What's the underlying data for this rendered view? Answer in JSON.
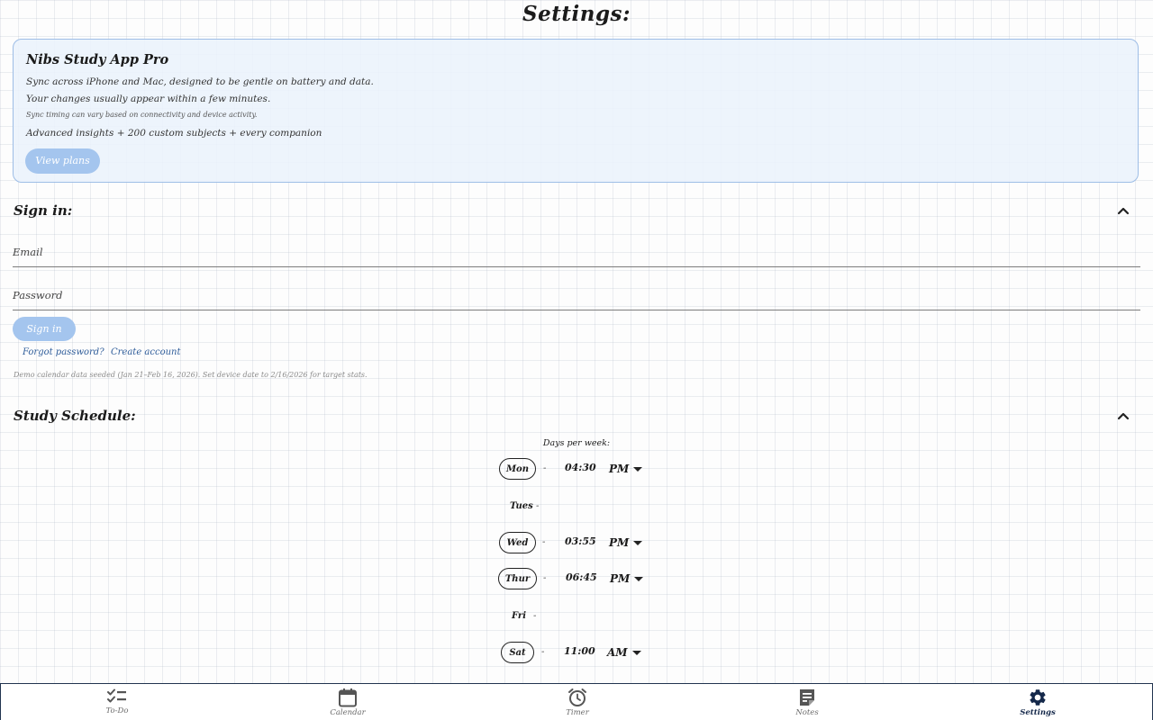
{
  "page": {
    "title": "Settings:"
  },
  "pro_card": {
    "title": "Nibs Study App Pro",
    "line1": "Sync across iPhone and Mac, designed to be gentle on battery and data.",
    "line2": "Your changes usually appear within a few minutes.",
    "line3": "Sync timing can vary based on connectivity and device activity.",
    "line4": "Advanced insights + 200 custom subjects + every companion",
    "button_label": "View plans"
  },
  "sign_in": {
    "heading": "Sign in:",
    "email_placeholder": "Email",
    "password_placeholder": "Password",
    "button_label": "Sign in",
    "forgot_label": "Forgot password?",
    "create_label": "Create account",
    "demo_note": "Demo calendar data seeded (Jan 21–Feb 16, 2026). Set device date to 2/16/2026 for target stats."
  },
  "schedule": {
    "heading": "Study Schedule:",
    "days_label": "Days per week:",
    "days": [
      {
        "day": "Mon",
        "active": true,
        "dash": "-",
        "time": "04:30",
        "ampm": "PM"
      },
      {
        "day": "Tues",
        "active": false,
        "dash": "-"
      },
      {
        "day": "Wed",
        "active": true,
        "dash": "-",
        "time": "03:55",
        "ampm": "PM"
      },
      {
        "day": "Thur",
        "active": true,
        "dash": "-",
        "time": "06:45",
        "ampm": "PM"
      },
      {
        "day": "Fri",
        "active": false,
        "dash": "-"
      },
      {
        "day": "Sat",
        "active": true,
        "dash": "-",
        "time": "11:00",
        "ampm": "AM"
      }
    ]
  },
  "tabbar": {
    "tabs": [
      {
        "label": "To-Do",
        "icon": "checklist-icon",
        "active": false
      },
      {
        "label": "Calendar",
        "icon": "calendar-icon",
        "active": false
      },
      {
        "label": "Timer",
        "icon": "alarm-clock-icon",
        "active": false
      },
      {
        "label": "Notes",
        "icon": "note-icon",
        "active": false
      },
      {
        "label": "Settings",
        "icon": "gear-icon",
        "active": true
      }
    ]
  },
  "colors": {
    "accent_button": "#a4c5ee",
    "card_border": "#9dbde6",
    "link": "#2f5d9a",
    "active_tab": "#14284a",
    "inactive_tab": "#6b6b6b"
  }
}
